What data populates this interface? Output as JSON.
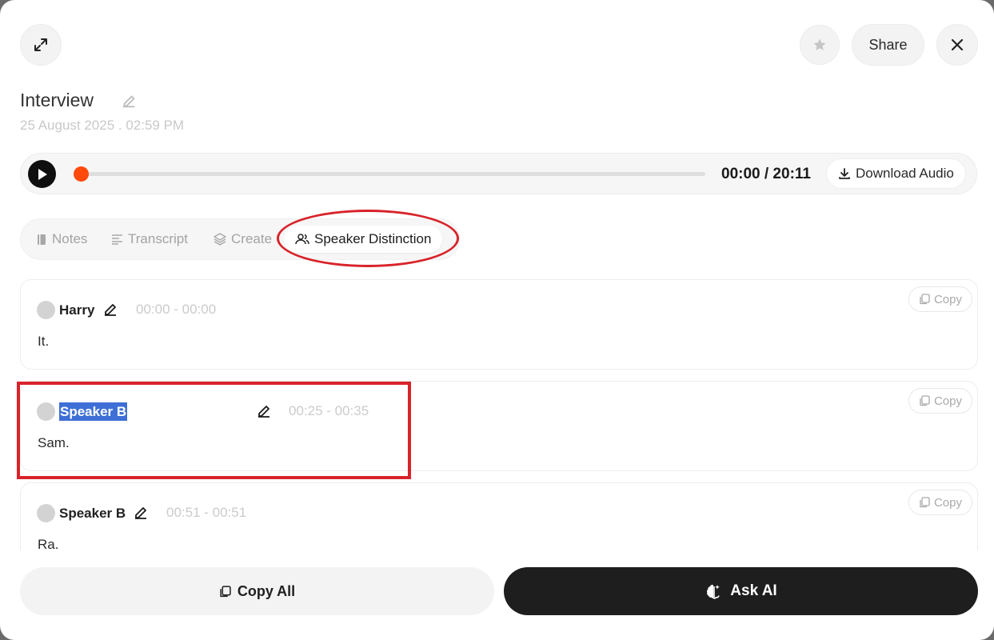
{
  "header": {
    "expand_icon": "expand-arrows-icon",
    "favorite_icon": "star-icon",
    "share_label": "Share",
    "close_icon": "close-icon"
  },
  "recording": {
    "title": "Interview",
    "date": "25 August 2025 . 02:59 PM"
  },
  "player": {
    "time": "00:00 / 20:11",
    "progress": 0,
    "download_label": "Download Audio",
    "accent_color": "#ff4a0c"
  },
  "tabs": [
    {
      "label": "Notes",
      "icon": "notebook-icon"
    },
    {
      "label": "Transcript",
      "icon": "lines-icon"
    },
    {
      "label": "Create",
      "icon": "layers-icon"
    },
    {
      "label": "Speaker Distinction",
      "icon": "users-icon",
      "active": true
    }
  ],
  "segments": [
    {
      "speaker": "Harry",
      "range": "00:00 - 00:00",
      "text": "It.",
      "copy_label": "Copy"
    },
    {
      "speaker": "Speaker B",
      "range": "00:25 - 00:35",
      "text": "Sam.",
      "copy_label": "Copy",
      "selected": true
    },
    {
      "speaker": "Speaker B",
      "range": "00:51 - 00:51",
      "text": "Ra.",
      "copy_label": "Copy"
    }
  ],
  "footer": {
    "copy_all_label": "Copy All",
    "ask_ai_label": "Ask AI"
  },
  "annotation_color": "#d8232a"
}
